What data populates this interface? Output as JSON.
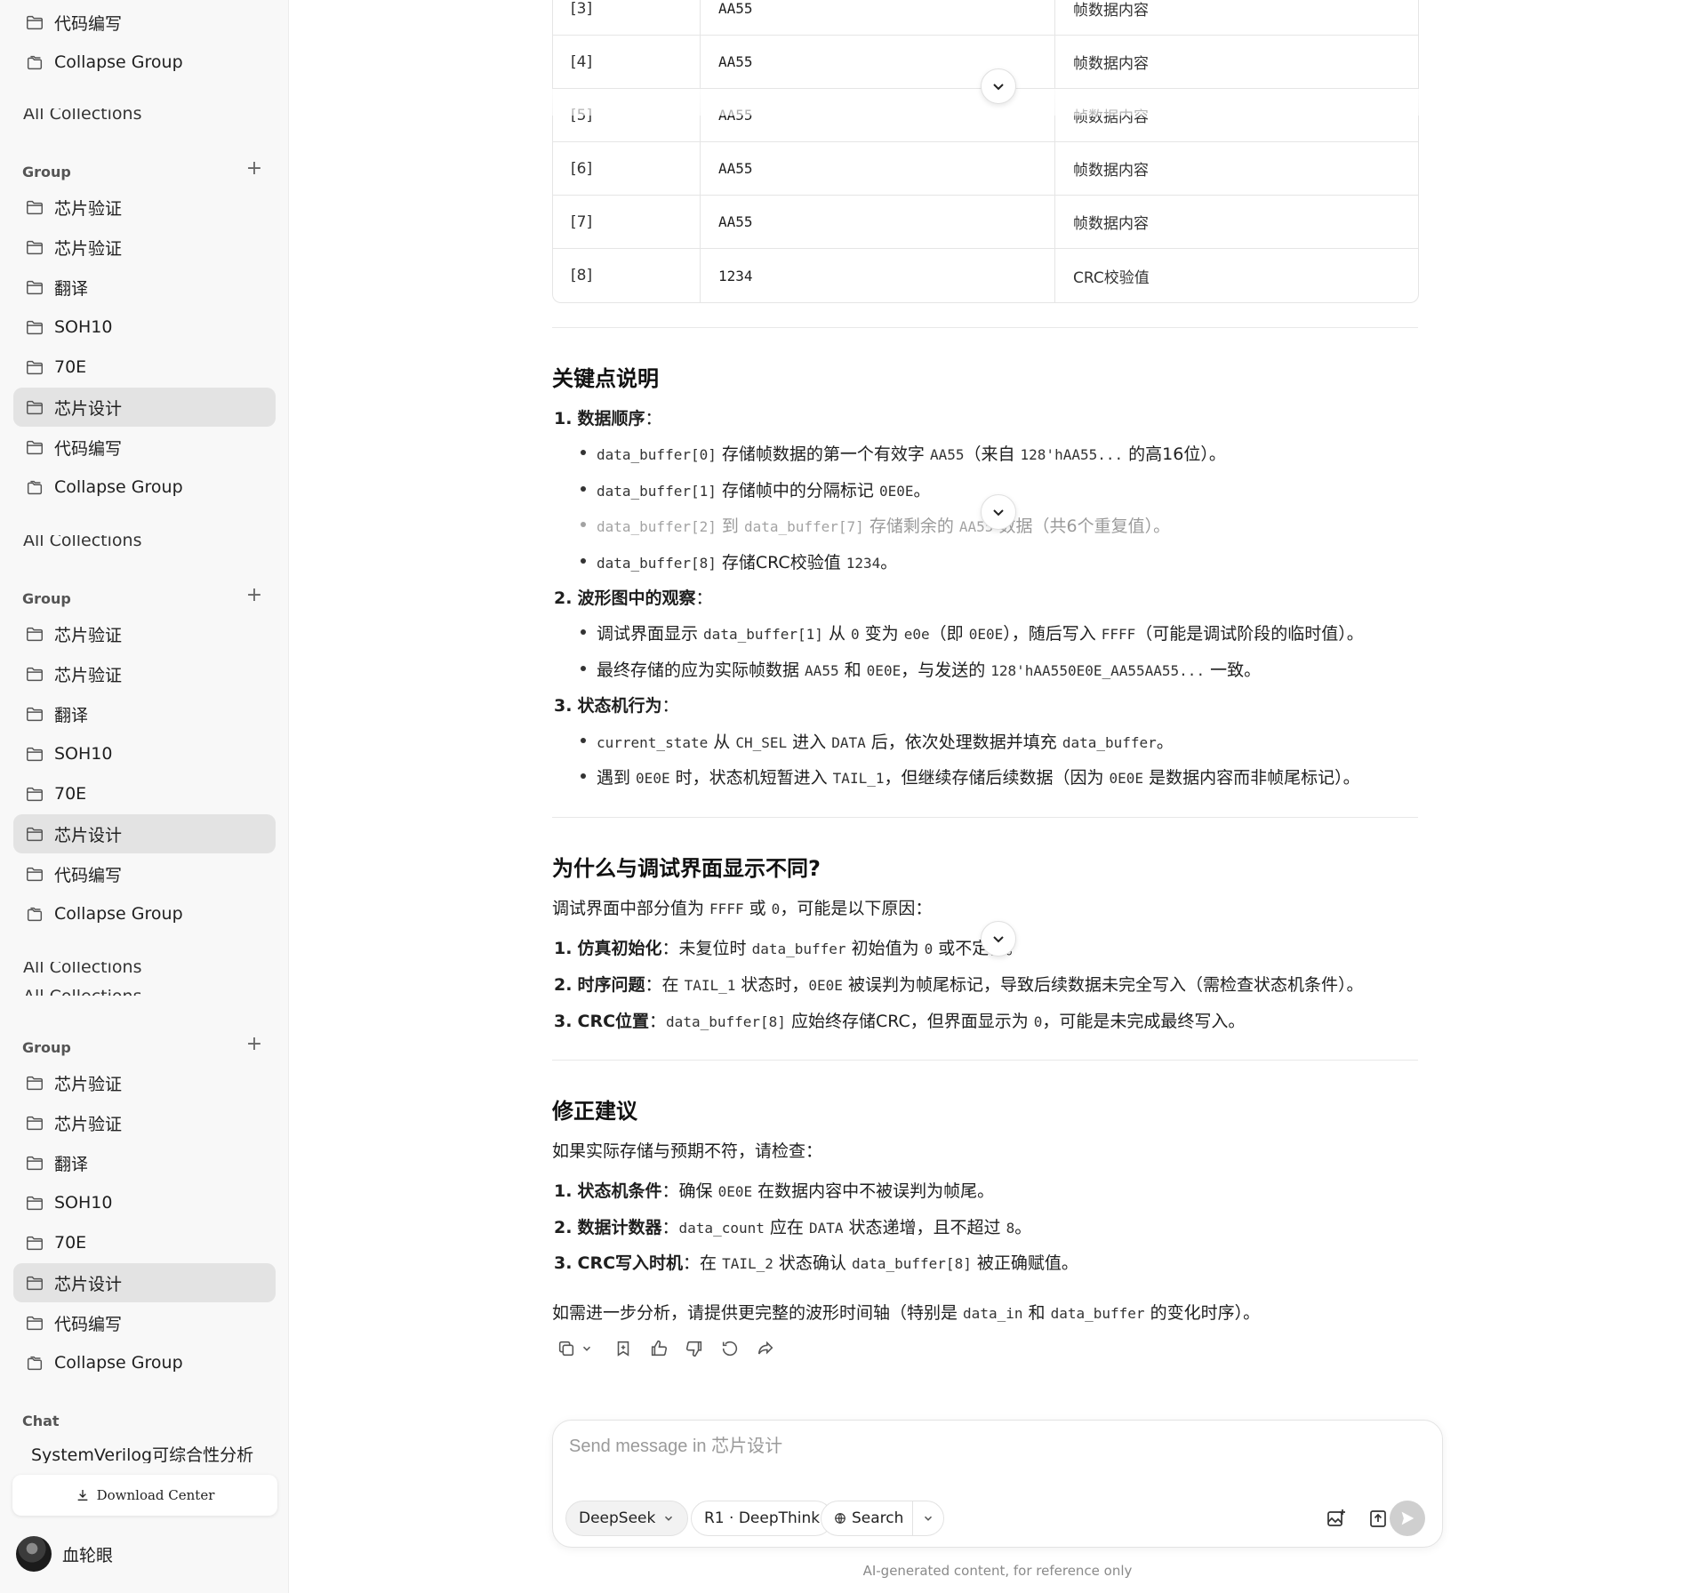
{
  "sidebar": {
    "top_items": [
      "代码编写",
      "Collapse Group"
    ],
    "ghost_label": "All Collections",
    "group_header": "Group",
    "groups": [
      {
        "items": [
          "芯片验证",
          "芯片验证",
          "翻译",
          "SOH10",
          "70E",
          "芯片设计",
          "代码编写",
          "Collapse Group"
        ]
      },
      {
        "items": [
          "芯片验证",
          "芯片验证",
          "翻译",
          "SOH10",
          "70E",
          "芯片设计",
          "代码编写",
          "Collapse Group"
        ]
      },
      {
        "items": [
          "芯片验证",
          "芯片验证",
          "翻译",
          "SOH10",
          "70E",
          "芯片设计",
          "代码编写",
          "Collapse Group"
        ]
      }
    ],
    "active_item": "芯片设计",
    "chat_header": "Chat",
    "chat_item": "SystemVerilog可综合性分析",
    "download_label": "Download Center",
    "user_name": "血轮眼"
  },
  "table": {
    "rows": [
      [
        "[3]",
        "AA55",
        "帧数据内容"
      ],
      [
        "[4]",
        "AA55",
        "帧数据内容"
      ],
      [
        "[5]",
        "AA55",
        "帧数据内容"
      ],
      [
        "[6]",
        "AA55",
        "帧数据内容"
      ],
      [
        "[7]",
        "AA55",
        "帧数据内容"
      ],
      [
        "[8]",
        "1234",
        "CRC校验值"
      ]
    ]
  },
  "sections": {
    "key_points": {
      "title": "关键点说明",
      "p1": {
        "num": "1.",
        "title": "数据顺序",
        "colon": "："
      },
      "p1_b1": [
        "data_buffer[0]",
        " 存储帧数据的第一个有效字 ",
        "AA55",
        "（来自 ",
        "128'hAA55...",
        " 的高16位）。"
      ],
      "p1_b2": [
        "data_buffer[1]",
        " 存储帧中的分隔标记 ",
        "0E0E",
        "。"
      ],
      "p1_b3": [
        "data_buffer[2]",
        " 到 ",
        "data_buffer[7]",
        " 存储剩余的 ",
        "AA55",
        " 数据（共6个重复值）。"
      ],
      "p1_b4": [
        "data_buffer[8]",
        " 存储CRC校验值 ",
        "1234",
        "。"
      ],
      "p2": {
        "num": "2.",
        "title": "波形图中的观察",
        "colon": "："
      },
      "p2_b1": [
        "调试界面显示 ",
        "data_buffer[1]",
        " 从 ",
        "0",
        " 变为 ",
        "e0e",
        "（即 ",
        "0E0E",
        "），随后写入 ",
        "FFFF",
        "（可能是调试阶段的临时值）。"
      ],
      "p2_b2": [
        "最终存储的应为实际帧数据 ",
        "AA55",
        " 和 ",
        "0E0E",
        "，与发送的 ",
        "128'hAA550E0E_AA55AA55...",
        " 一致。"
      ],
      "p3": {
        "num": "3.",
        "title": "状态机行为",
        "colon": "："
      },
      "p3_b1": [
        "current_state",
        " 从 ",
        "CH_SEL",
        " 进入 ",
        "DATA",
        " 后，依次处理数据并填充 ",
        "data_buffer",
        "。"
      ],
      "p3_b2": [
        "遇到 ",
        "0E0E",
        " 时，状态机短暂进入 ",
        "TAIL_1",
        "，但继续存储后续数据（因为 ",
        "0E0E",
        " 是数据内容而非帧尾标记）。"
      ]
    },
    "why": {
      "title": "为什么与调试界面显示不同?",
      "intro": [
        "调试界面中部分值为 ",
        "FFFF",
        " 或 ",
        "0",
        "，可能是以下原因："
      ],
      "n1": {
        "num": "1.",
        "title": "仿真初始化",
        "parts": [
          "：未复位时 ",
          "data_buffer",
          " 初始值为 ",
          "0",
          " 或不定值。"
        ]
      },
      "n2": {
        "num": "2.",
        "title": "时序问题",
        "parts": [
          "：在 ",
          "TAIL_1",
          " 状态时，",
          "0E0E",
          " 被误判为帧尾标记，导致后续数据未完全写入（需检查状态机条件）。"
        ]
      },
      "n3": {
        "num": "3.",
        "title": "CRC位置",
        "parts": [
          "：",
          "data_buffer[8]",
          " 应始终存储CRC，但界面显示为 ",
          "0",
          "，可能是未完成最终写入。"
        ]
      }
    },
    "fix": {
      "title": "修正建议",
      "intro": "如果实际存储与预期不符，请检查：",
      "n1": {
        "num": "1.",
        "title": "状态机条件",
        "parts": [
          "：确保 ",
          "0E0E",
          " 在数据内容中不被误判为帧尾。"
        ]
      },
      "n2": {
        "num": "2.",
        "title": "数据计数器",
        "parts": [
          "：",
          "data_count",
          " 应在 ",
          "DATA",
          " 状态递增，且不超过 ",
          "8",
          "。"
        ]
      },
      "n3": {
        "num": "3.",
        "title": "CRC写入时机",
        "parts": [
          "：在 ",
          "TAIL_2",
          " 状态确认 ",
          "data_buffer[8]",
          " 被正确赋值。"
        ]
      },
      "closing": [
        "如需进一步分析，请提供更完整的波形时间轴（特别是 ",
        "data_in",
        " 和 ",
        "data_buffer",
        " 的变化时序）。"
      ]
    }
  },
  "composer": {
    "placeholder": "Send message in 芯片设计",
    "model_label": "DeepSeek",
    "deepthink_label": "R1 · DeepThink",
    "search_label": "Search"
  },
  "footer_note": "AI-generated content, for reference only"
}
